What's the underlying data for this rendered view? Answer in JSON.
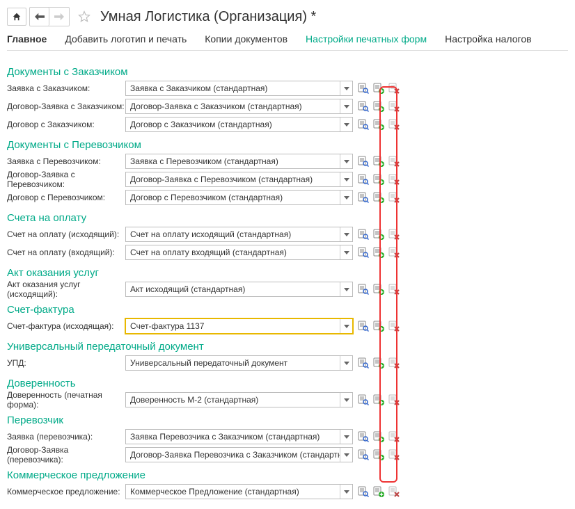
{
  "header": {
    "title": "Умная Логистика (Организация) *"
  },
  "tabs": [
    {
      "label": "Главное",
      "bold": true
    },
    {
      "label": "Добавить логотип и печать"
    },
    {
      "label": "Копии документов"
    },
    {
      "label": "Настройки печатных форм",
      "active": true
    },
    {
      "label": "Настройка налогов"
    }
  ],
  "sections": [
    {
      "title": "Документы с Заказчиком",
      "rows": [
        {
          "label": "Заявка с Заказчиком:",
          "value": "Заявка с Заказчиком (стандартная)"
        },
        {
          "label": "Договор-Заявка с Заказчиком:",
          "value": "Договор-Заявка с Заказчиком (стандартная)"
        },
        {
          "label": "Договор с Заказчиком:",
          "value": "Договор с Заказчиком (стандартная)"
        }
      ]
    },
    {
      "title": "Документы с Перевозчиком",
      "rows": [
        {
          "label": "Заявка с Перевозчиком:",
          "value": "Заявка с Перевозчиком (стандартная)"
        },
        {
          "label": "Договор-Заявка с Перевозчиком:",
          "value": "Договор-Заявка с Перевозчиком (стандартная)"
        },
        {
          "label": "Договор с Перевозчиком:",
          "value": "Договор с Перевозчиком (стандартная)"
        }
      ]
    },
    {
      "title": "Счета на оплату",
      "rows": [
        {
          "label": "Счет на оплату (исходящий):",
          "value": "Счет на оплату исходящий (стандартная)"
        },
        {
          "label": "Счет на оплату (входящий):",
          "value": "Счет на оплату входящий (стандартная)"
        }
      ]
    },
    {
      "title": "Акт оказания услуг",
      "rows": [
        {
          "label": "Акт оказания услуг (исходящий):",
          "value": "Акт исходящий (стандартная)"
        }
      ]
    },
    {
      "title": "Счет-фактура",
      "rows": [
        {
          "label": "Счет-фактура (исходящая):",
          "value": "Счет-фактура 1137",
          "highlight": true
        }
      ]
    },
    {
      "title": "Универсальный передаточный документ",
      "rows": [
        {
          "label": "УПД:",
          "value": "Универсальный передаточный документ"
        }
      ]
    },
    {
      "title": "Доверенность",
      "rows": [
        {
          "label": "Доверенность (печатная форма):",
          "value": "Доверенность М-2 (стандартная)"
        }
      ]
    },
    {
      "title": "Перевозчик",
      "rows": [
        {
          "label": "Заявка (перевозчика):",
          "value": "Заявка Перевозчика с Заказчиком (стандартная)"
        },
        {
          "label": "Договор-Заявка (перевозчика):",
          "value": "Договор-Заявка Перевозчика с Заказчиком (стандартная)"
        }
      ]
    },
    {
      "title": "Коммерческое предложение",
      "rows": [
        {
          "label": "Коммерческое предложение:",
          "value": "Коммерческое Предложение (стандартная)"
        }
      ]
    }
  ]
}
